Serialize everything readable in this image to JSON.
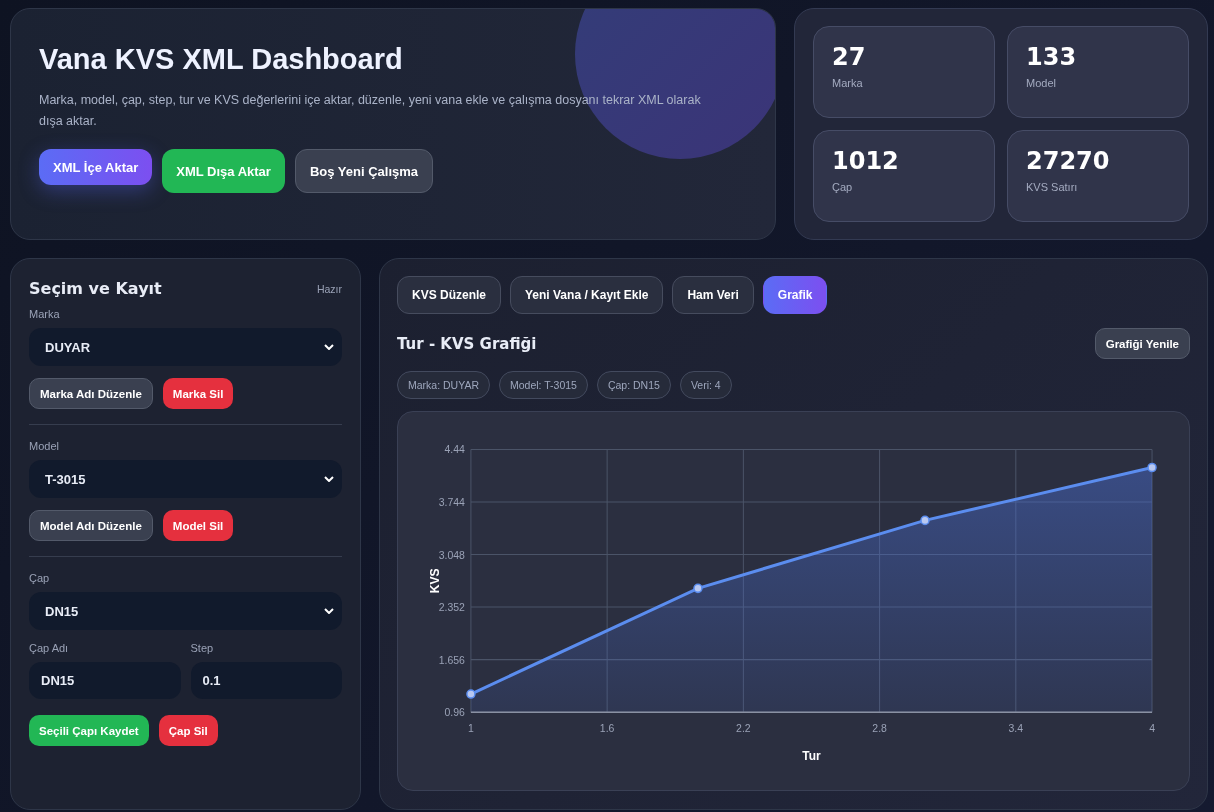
{
  "hero": {
    "title": "Vana KVS XML Dashboard",
    "description": "Marka, model, çap, step, tur ve KVS değerlerini içe aktar, düzenle, yeni vana ekle ve çalışma dosyanı tekrar XML olarak dışa aktar.",
    "buttons": [
      {
        "label": "XML İçe Aktar",
        "kind": "primary"
      },
      {
        "label": "XML Dışa Aktar",
        "kind": "success"
      },
      {
        "label": "Boş Yeni Çalışma",
        "kind": "secondary"
      }
    ]
  },
  "stats": [
    {
      "value": "27",
      "label": "Marka"
    },
    {
      "value": "133",
      "label": "Model"
    },
    {
      "value": "1012",
      "label": "Çap"
    },
    {
      "value": "27270",
      "label": "KVS Satırı"
    }
  ],
  "sidebar": {
    "title": "Seçim ve Kayıt",
    "status": "Hazır",
    "sections": [
      {
        "label": "Marka",
        "value": "DUYAR",
        "buttons": [
          {
            "label": "Marka Adı Düzenle",
            "kind": "secondary"
          },
          {
            "label": "Marka Sil",
            "kind": "danger"
          }
        ]
      },
      {
        "label": "Model",
        "value": "T-3015",
        "buttons": [
          {
            "label": "Model Adı Düzenle",
            "kind": "secondary"
          },
          {
            "label": "Model Sil",
            "kind": "danger"
          }
        ]
      },
      {
        "label": "Çap",
        "value": "DN15",
        "fields": [
          {
            "label": "Çap Adı",
            "value": "DN15"
          },
          {
            "label": "Step",
            "value": "0.1"
          }
        ],
        "buttons": [
          {
            "label": "Seçili Çapı Kaydet",
            "kind": "success"
          },
          {
            "label": "Çap Sil",
            "kind": "danger"
          }
        ]
      }
    ]
  },
  "tabs": [
    {
      "label": "KVS Düzenle",
      "selected": false
    },
    {
      "label": "Yeni Vana / Kayıt Ekle",
      "selected": false
    },
    {
      "label": "Ham Veri",
      "selected": false
    },
    {
      "label": "Grafik",
      "selected": true
    }
  ],
  "chart_panel": {
    "title": "Tur - KVS Grafiği",
    "refresh_button": "Grafiği Yenile",
    "chips": [
      "Marka: DUYAR",
      "Model: T-3015",
      "Çap: DN15",
      "Veri: 4"
    ],
    "chart_data": {
      "type": "area",
      "xlabel": "Tur",
      "ylabel": "KVS",
      "x": [
        1,
        2,
        3,
        4
      ],
      "series": [
        {
          "color": "#5b8def",
          "values": [
            1.2,
            2.6,
            3.5,
            4.2
          ]
        }
      ],
      "grid": true,
      "xlim": [
        1,
        4
      ],
      "ylim": [
        0.96,
        4.44
      ],
      "xticks": [
        1,
        1.6,
        2.2,
        2.8,
        3.4,
        4
      ],
      "yticks": [
        0.96,
        1.656,
        2.352,
        3.048,
        3.744,
        4.44
      ]
    }
  }
}
